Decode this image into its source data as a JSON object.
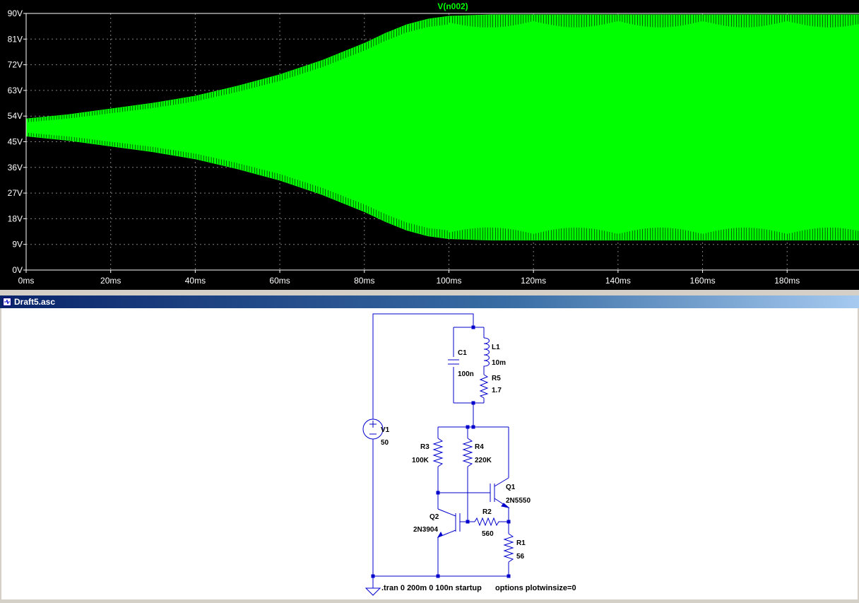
{
  "plot": {
    "trace_name": "V(n002)",
    "trace_color": "#00ff00",
    "background": "#000000",
    "y_ticks": [
      "90V",
      "81V",
      "72V",
      "63V",
      "54V",
      "45V",
      "36V",
      "27V",
      "18V",
      "9V",
      "0V"
    ],
    "x_ticks": [
      "0ms",
      "20ms",
      "40ms",
      "60ms",
      "80ms",
      "100ms",
      "120ms",
      "140ms",
      "160ms",
      "180ms"
    ]
  },
  "chart_data": {
    "type": "area",
    "series": [
      {
        "name": "V(n002)",
        "x_ms": [
          0,
          10,
          20,
          30,
          40,
          50,
          60,
          70,
          80,
          85,
          90,
          95,
          100,
          110,
          120,
          130,
          140,
          150,
          160,
          170,
          180,
          190,
          197
        ],
        "upper_V": [
          53,
          54.5,
          56.5,
          58.5,
          61,
          64.5,
          68.5,
          73.5,
          79.5,
          83,
          86,
          88,
          89,
          89.5,
          89.5,
          89.5,
          89.5,
          89.5,
          89.5,
          89.5,
          89.5,
          89.5,
          89.5
        ],
        "lower_V": [
          47,
          45.5,
          43.5,
          41.5,
          39,
          35.5,
          31.5,
          26.5,
          20.5,
          17,
          14,
          12,
          11,
          10.5,
          10.5,
          10.5,
          10.5,
          10.5,
          10.5,
          10.5,
          10.5,
          10.5,
          10.5
        ]
      }
    ],
    "xlim": [
      0,
      197
    ],
    "ylim": [
      0,
      90
    ],
    "grid": true
  },
  "schematic_window": {
    "title": "Draft5.asc"
  },
  "schematic": {
    "components": {
      "V1": {
        "name": "V1",
        "value": "50"
      },
      "C1": {
        "name": "C1",
        "value": "100n"
      },
      "L1": {
        "name": "L1",
        "value": "10m"
      },
      "R5": {
        "name": "R5",
        "value": "1.7"
      },
      "R3": {
        "name": "R3",
        "value": "100K"
      },
      "R4": {
        "name": "R4",
        "value": "220K"
      },
      "R2": {
        "name": "R2",
        "value": "560"
      },
      "R1": {
        "name": "R1",
        "value": "56"
      },
      "Q1": {
        "name": "Q1",
        "value": "2N5550"
      },
      "Q2": {
        "name": "Q2",
        "value": "2N3904"
      }
    },
    "directive": ".tran 0 200m 0 100n startup",
    "directive2": "options plotwinsize=0",
    "wire_color": "#0000cc"
  }
}
